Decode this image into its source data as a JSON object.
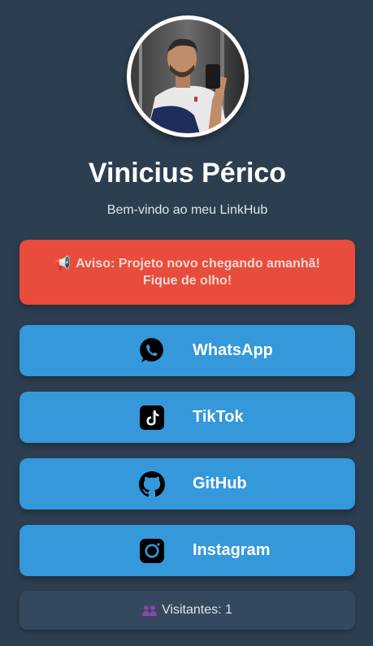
{
  "profile": {
    "name": "Vinicius Périco",
    "subtitle": "Bem-vindo ao meu LinkHub",
    "avatar": "profile-photo"
  },
  "notice": {
    "icon": "megaphone-icon",
    "text": "Aviso: Projeto novo chegando amanhã! Fique de olho!",
    "color": "#e74c3c"
  },
  "links": [
    {
      "label": "WhatsApp",
      "icon": "whatsapp-icon"
    },
    {
      "label": "TikTok",
      "icon": "tiktok-icon"
    },
    {
      "label": "GitHub",
      "icon": "github-icon"
    },
    {
      "label": "Instagram",
      "icon": "instagram-icon"
    }
  ],
  "visitors": {
    "icon": "people-icon",
    "text": "Visitantes: 1"
  },
  "colors": {
    "background": "#2c3e50",
    "button": "#3498db",
    "notice": "#e74c3c",
    "visitors_panel": "#34495e"
  }
}
